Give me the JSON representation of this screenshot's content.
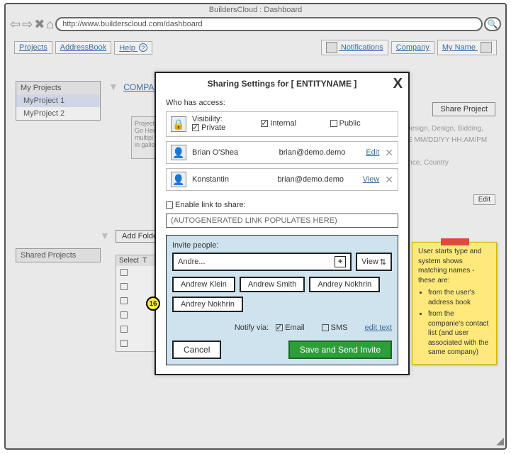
{
  "window": {
    "title": "BuildersCloud : Dashboard"
  },
  "url": "http://www.builderscloud.com/dashboard",
  "nav_left": {
    "projects": "Projects",
    "addressbook": "AddressBook",
    "help": "Help"
  },
  "nav_right": {
    "notifications": "Notifications",
    "company": "Company",
    "myname": "My Name"
  },
  "sidebar": {
    "my_projects": {
      "title": "My Projects",
      "items": [
        "MyProject 1",
        "MyProject 2"
      ],
      "active_index": 0
    },
    "shared_projects": {
      "title": "Shared Projects"
    }
  },
  "main": {
    "company_label": "COMPANY",
    "share_button": "Share Project",
    "phases": "-Design, Design, Bidding,",
    "date_fmt": "TE MM/DD/YY HH:AM/PM",
    "location": "vince, Country",
    "edit_chip": "Edit",
    "add_folder": "Add Folder",
    "list_header": "Select",
    "preview_text": "Project\nGo Her\nmultipl\nin galle"
  },
  "modal": {
    "title": "Sharing Settings for [ ENTITYNAME ]",
    "who_has_access": "Who has access:",
    "visibility_label": "Visibility:",
    "visibility_options": {
      "private": "Private",
      "internal": "Internal",
      "public": "Public"
    },
    "visibility_checked": {
      "private": true,
      "internal": true,
      "public": false
    },
    "users": [
      {
        "name": "Brian O'Shea",
        "email": "brian@demo.demo",
        "action": "Edit"
      },
      {
        "name": "Konstantin",
        "email": "brian@demo.demo",
        "action": "View"
      }
    ],
    "enable_link_label": "Enable link to share:",
    "enable_link_checked": false,
    "generated_link": "(AUTOGENERATED LINK POPULATES HERE)",
    "invite": {
      "label": "Invite people:",
      "input_value": "Andre...",
      "view_button": "View",
      "suggestions": [
        "Andrew Klein",
        "Andrew Smith",
        "Andrey Nokhrin",
        "Andrey Nokhrin"
      ]
    },
    "notify": {
      "label": "Notify via:",
      "email": "Email",
      "email_checked": true,
      "sms": "SMS",
      "sms_checked": false,
      "edit_text": "edit text"
    },
    "cancel": "Cancel",
    "save": "Save and Send Invite"
  },
  "callout": {
    "number": "16"
  },
  "sticky": {
    "intro": "User starts type and system shows matching names - these are:",
    "bullets": [
      "from the user's address book",
      "from the companie's contact list (and user associated with the same company)"
    ]
  }
}
